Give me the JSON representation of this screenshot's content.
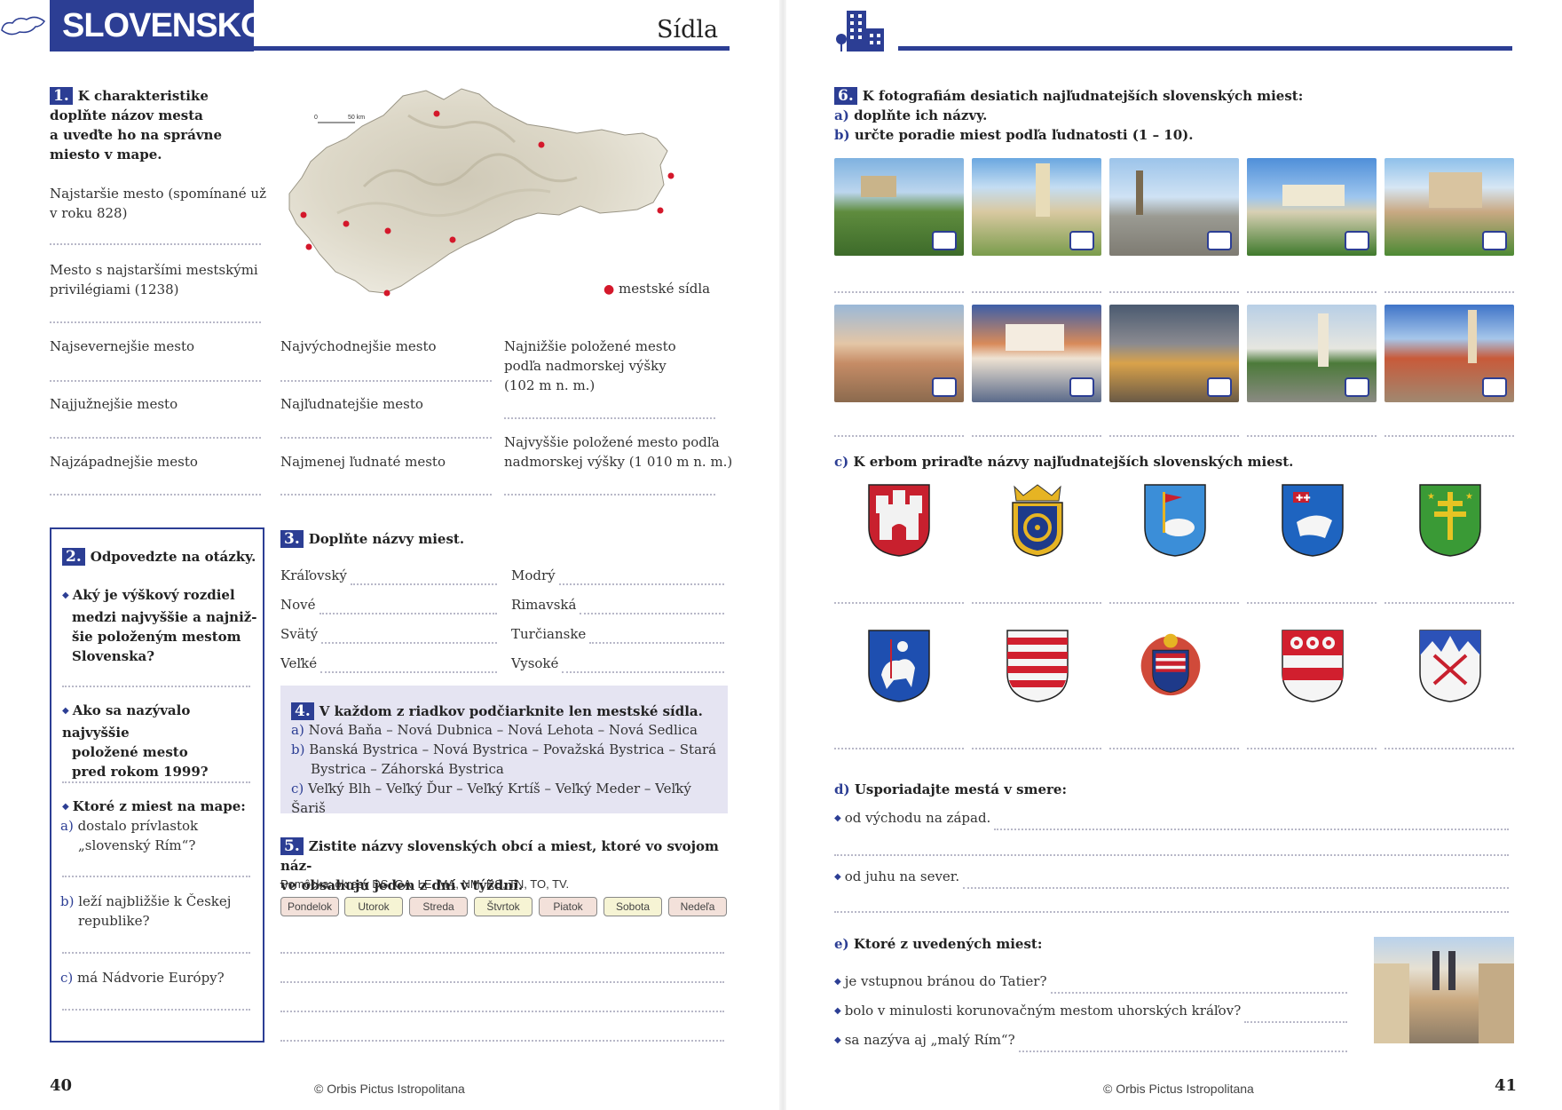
{
  "left_page": {
    "banner": "SLOVENSKO",
    "title": "Sídla",
    "page_number": "40",
    "footer": "© Orbis Pictus Istropolitana",
    "map": {
      "scale_zero": "0",
      "scale_label": "50 km",
      "legend": "mestské sídla"
    },
    "task1": {
      "num": "1.",
      "text_lines": [
        "K charakteristike",
        "doplňte názov mesta",
        "a uveďte ho na správne",
        "miesto v mape."
      ],
      "items": {
        "oldest_l1": "Najstaršie mesto (spomínané už",
        "oldest_l2": "v roku 828)",
        "privileges_l1": "Mesto s najstaršími mestskými",
        "privileges_l2": "privilégiami (1238)",
        "north": "Najsevernejšie mesto",
        "south": "Najjužnejšie mesto",
        "west": "Najzápadnejšie mesto",
        "east": "Najvýchodnejšie mesto",
        "populous": "Najľudnatejšie mesto",
        "least": "Najmenej ľudnaté mesto",
        "lowest_l1": "Najnižšie položené mesto",
        "lowest_l2": "podľa nadmorskej výšky",
        "lowest_l3": "(102 m n. m.)",
        "highest_l1": "Najvyššie položené mesto podľa",
        "highest_l2": "nadmorskej výšky (1 010 m n. m.)"
      }
    },
    "task2": {
      "num": "2.",
      "title": "Odpovedzte na otázky.",
      "q1": [
        "Aký je výškový rozdiel",
        "medzi najvyššie a najniž-",
        "šie položeným mestom",
        "Slovenska?"
      ],
      "q2": [
        "Ako sa nazývalo najvyššie",
        "položené mesto",
        "pred rokom 1999?"
      ],
      "q3": "Ktoré z miest na mape:",
      "a_label": "a)",
      "a_text": [
        "dostalo prívlastok",
        "„slovenský Rím“?"
      ],
      "b_label": "b)",
      "b_text": [
        "leží najbližšie k Českej",
        "republike?"
      ],
      "c_label": "c)",
      "c_text": "má Nádvorie Európy?"
    },
    "task3": {
      "num": "3.",
      "title": "Doplňte názvy miest.",
      "left": [
        "Kráľovský",
        "Nové",
        "Svätý",
        "Veľké"
      ],
      "right": [
        "Modrý",
        "Rimavská",
        "Turčianske",
        "Vysoké"
      ]
    },
    "task4": {
      "num": "4.",
      "title": "V každom z riadkov podčiarknite len mestské sídla.",
      "a_label": "a)",
      "a": "Nová Baňa – Nová Dubnica – Nová Lehota – Nová Sedlica",
      "b_label": "b)",
      "b1": "Banská Bystrica – Nová Bystrica – Považská Bystrica – Stará",
      "b2": "Bystrica – Záhorská Bystrica",
      "c_label": "c)",
      "c": "Veľký Blh – Veľký Ďur – Veľký Krtíš – Veľký Meder – Veľký Šariš"
    },
    "task5": {
      "num": "5.",
      "title_l1": "Zistite názvy slovenských obcí a miest, ktoré vo svojom náz-",
      "title_l2": "ve obsahujú jeden z dní v týždni.",
      "hint": "Pomôcka: okresy DS, GA, LE, MA, NM, RS, TN, TO, TV.",
      "days": [
        "Pondelok",
        "Utorok",
        "Streda",
        "Štvrtok",
        "Piatok",
        "Sobota",
        "Nedeľa"
      ]
    }
  },
  "right_page": {
    "page_number": "41",
    "footer": "© Orbis Pictus Istropolitana",
    "task6": {
      "num": "6.",
      "title": "K fotografiám desiatich najľudnatejších slovenských miest:",
      "a_label": "a)",
      "a": "doplňte ich názvy.",
      "b_label": "b)",
      "b": "určte poradie miest podľa ľudnatosti (1 – 10).",
      "c_label": "c)",
      "c": "K erbom priraďte názvy najľudnatejších slovenských miest.",
      "d_label": "d)",
      "d": "Usporiadajte mestá v smere:",
      "d1": "od východu na západ.",
      "d2": "od juhu na sever.",
      "e_label": "e)",
      "e": "Ktoré z uvedených miest:",
      "e1": "je vstupnou bránou do Tatier?",
      "e2": "bolo v minulosti korunovačným mestom uhorských kráľov?",
      "e3": "sa nazýva aj „malý Rím“?"
    }
  },
  "colors": {
    "accent": "#2c3e94",
    "task4_bg": "#e5e4f2",
    "map_dot": "#d4182b"
  }
}
